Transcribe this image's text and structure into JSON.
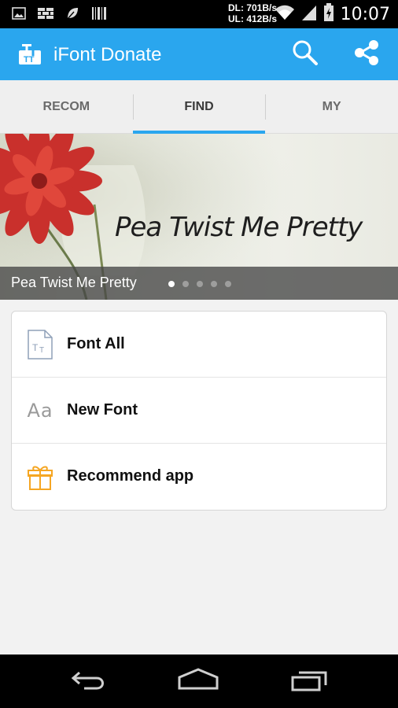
{
  "status_bar": {
    "download_speed": "DL: 701B/s",
    "upload_speed": "UL: 412B/s",
    "time": "10:07",
    "icons": [
      "gallery-icon",
      "wall-icon",
      "leaf-icon",
      "barcode-icon",
      "wifi-icon",
      "signal-icon",
      "battery-charging-icon"
    ]
  },
  "app_bar": {
    "title": "iFont Donate",
    "logo_icon": "ifont-logo-icon",
    "actions": [
      "search-icon",
      "share-icon"
    ],
    "color": "#2aa6ee"
  },
  "tabs": [
    {
      "label": "RECOM",
      "active": false
    },
    {
      "label": "FIND",
      "active": true
    },
    {
      "label": "MY",
      "active": false
    }
  ],
  "banner": {
    "caption": "Pea Twist Me Pretty",
    "script_text": "Pea Twist Me Pretty",
    "slide_count": 5,
    "active_slide": 1
  },
  "menu": [
    {
      "label": "Font All",
      "icon": "font-file-icon"
    },
    {
      "label": "New Font",
      "icon": "aa-icon",
      "icon_text": "Aa"
    },
    {
      "label": "Recommend app",
      "icon": "gift-icon",
      "icon_color": "#f5a623"
    }
  ],
  "nav_bar": {
    "buttons": [
      "back-icon",
      "home-icon",
      "recent-apps-icon"
    ]
  }
}
